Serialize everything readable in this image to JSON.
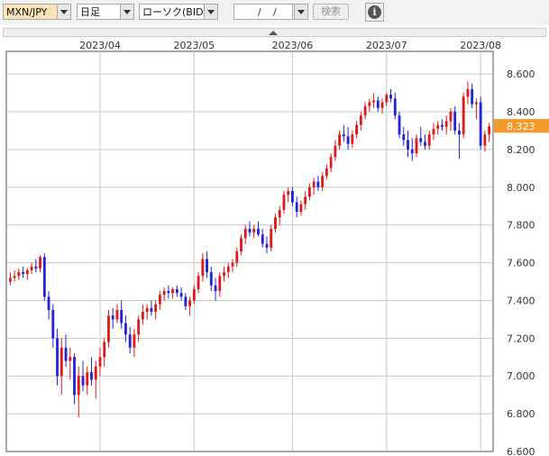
{
  "toolbar": {
    "symbol": "MXN/JPY",
    "period": "日足",
    "chart_type": "ローソク(BID)",
    "date_sep1": "/",
    "date_sep2": "/",
    "search_label": "検索",
    "info_label": "i"
  },
  "colors": {
    "up": "#e01a1a",
    "down": "#2424d6",
    "grid": "#c8c8c8",
    "badge": "#f39a2b"
  },
  "chart_data": {
    "type": "candlestick",
    "x_tick_labels": [
      "2023/04",
      "2023/05",
      "2023/06",
      "2023/07",
      "2023/08"
    ],
    "y_tick_labels": [
      "8.600",
      "8.400",
      "8.200",
      "8.000",
      "7.800",
      "7.600",
      "7.400",
      "7.200",
      "7.000",
      "6.800",
      "6.600"
    ],
    "y_ticks": [
      8.6,
      8.4,
      8.2,
      8.0,
      7.8,
      7.6,
      7.4,
      7.2,
      7.0,
      6.8,
      6.6
    ],
    "ylim": [
      6.6,
      8.72
    ],
    "current_price": 8.323,
    "current_price_label": "8.323",
    "month_start_index": [
      21,
      43,
      66,
      88,
      110
    ],
    "ohlc": [
      [
        7.5,
        7.55,
        7.48,
        7.52
      ],
      [
        7.52,
        7.56,
        7.5,
        7.53
      ],
      [
        7.53,
        7.57,
        7.51,
        7.55
      ],
      [
        7.55,
        7.58,
        7.52,
        7.54
      ],
      [
        7.54,
        7.57,
        7.51,
        7.56
      ],
      [
        7.56,
        7.6,
        7.54,
        7.58
      ],
      [
        7.58,
        7.62,
        7.55,
        7.57
      ],
      [
        7.57,
        7.64,
        7.55,
        7.63
      ],
      [
        7.63,
        7.65,
        7.4,
        7.42
      ],
      [
        7.42,
        7.45,
        7.3,
        7.35
      ],
      [
        7.35,
        7.38,
        7.15,
        7.2
      ],
      [
        7.2,
        7.25,
        6.95,
        7.0
      ],
      [
        7.0,
        7.2,
        6.9,
        7.15
      ],
      [
        7.15,
        7.22,
        7.05,
        7.08
      ],
      [
        7.08,
        7.15,
        6.98,
        7.1
      ],
      [
        7.1,
        7.12,
        6.85,
        6.9
      ],
      [
        6.9,
        7.05,
        6.78,
        7.0
      ],
      [
        7.0,
        7.08,
        6.92,
        6.95
      ],
      [
        6.95,
        7.05,
        6.9,
        7.02
      ],
      [
        7.02,
        7.1,
        6.95,
        6.98
      ],
      [
        6.98,
        7.08,
        6.88,
        7.05
      ],
      [
        7.05,
        7.15,
        7.0,
        7.1
      ],
      [
        7.1,
        7.2,
        7.05,
        7.18
      ],
      [
        7.18,
        7.35,
        7.15,
        7.32
      ],
      [
        7.32,
        7.36,
        7.25,
        7.3
      ],
      [
        7.3,
        7.38,
        7.28,
        7.35
      ],
      [
        7.35,
        7.4,
        7.25,
        7.28
      ],
      [
        7.28,
        7.32,
        7.18,
        7.22
      ],
      [
        7.22,
        7.26,
        7.12,
        7.15
      ],
      [
        7.15,
        7.25,
        7.1,
        7.22
      ],
      [
        7.22,
        7.32,
        7.18,
        7.3
      ],
      [
        7.3,
        7.38,
        7.27,
        7.34
      ],
      [
        7.34,
        7.38,
        7.3,
        7.36
      ],
      [
        7.36,
        7.4,
        7.32,
        7.34
      ],
      [
        7.34,
        7.4,
        7.3,
        7.38
      ],
      [
        7.38,
        7.45,
        7.35,
        7.43
      ],
      [
        7.43,
        7.47,
        7.4,
        7.45
      ],
      [
        7.45,
        7.48,
        7.41,
        7.44
      ],
      [
        7.44,
        7.47,
        7.41,
        7.46
      ],
      [
        7.46,
        7.48,
        7.42,
        7.44
      ],
      [
        7.44,
        7.47,
        7.4,
        7.42
      ],
      [
        7.42,
        7.44,
        7.35,
        7.37
      ],
      [
        7.37,
        7.42,
        7.32,
        7.4
      ],
      [
        7.4,
        7.48,
        7.38,
        7.46
      ],
      [
        7.46,
        7.55,
        7.44,
        7.53
      ],
      [
        7.53,
        7.65,
        7.5,
        7.62
      ],
      [
        7.62,
        7.66,
        7.52,
        7.55
      ],
      [
        7.55,
        7.58,
        7.45,
        7.48
      ],
      [
        7.48,
        7.52,
        7.4,
        7.45
      ],
      [
        7.45,
        7.55,
        7.42,
        7.53
      ],
      [
        7.53,
        7.58,
        7.5,
        7.55
      ],
      [
        7.55,
        7.6,
        7.52,
        7.58
      ],
      [
        7.58,
        7.62,
        7.55,
        7.6
      ],
      [
        7.6,
        7.68,
        7.58,
        7.66
      ],
      [
        7.66,
        7.75,
        7.64,
        7.73
      ],
      [
        7.73,
        7.8,
        7.7,
        7.78
      ],
      [
        7.78,
        7.82,
        7.74,
        7.76
      ],
      [
        7.76,
        7.8,
        7.73,
        7.78
      ],
      [
        7.78,
        7.82,
        7.74,
        7.75
      ],
      [
        7.75,
        7.78,
        7.68,
        7.7
      ],
      [
        7.7,
        7.74,
        7.65,
        7.68
      ],
      [
        7.68,
        7.8,
        7.66,
        7.78
      ],
      [
        7.78,
        7.86,
        7.76,
        7.84
      ],
      [
        7.84,
        7.9,
        7.8,
        7.88
      ],
      [
        7.88,
        7.98,
        7.86,
        7.96
      ],
      [
        7.96,
        8.0,
        7.92,
        7.98
      ],
      [
        7.98,
        8.0,
        7.9,
        7.92
      ],
      [
        7.92,
        7.95,
        7.84,
        7.87
      ],
      [
        7.87,
        7.93,
        7.85,
        7.91
      ],
      [
        7.91,
        7.98,
        7.88,
        7.95
      ],
      [
        7.95,
        8.02,
        7.93,
        8.0
      ],
      [
        8.0,
        8.05,
        7.96,
        8.03
      ],
      [
        8.03,
        8.06,
        7.98,
        8.0
      ],
      [
        8.0,
        8.08,
        7.98,
        8.06
      ],
      [
        8.06,
        8.12,
        8.04,
        8.1
      ],
      [
        8.1,
        8.18,
        8.08,
        8.16
      ],
      [
        8.16,
        8.25,
        8.14,
        8.22
      ],
      [
        8.22,
        8.3,
        8.2,
        8.28
      ],
      [
        8.28,
        8.33,
        8.24,
        8.27
      ],
      [
        8.27,
        8.32,
        8.2,
        8.23
      ],
      [
        8.23,
        8.3,
        8.21,
        8.28
      ],
      [
        8.28,
        8.35,
        8.26,
        8.33
      ],
      [
        8.33,
        8.4,
        8.3,
        8.38
      ],
      [
        8.38,
        8.45,
        8.36,
        8.43
      ],
      [
        8.43,
        8.47,
        8.4,
        8.45
      ],
      [
        8.45,
        8.5,
        8.42,
        8.46
      ],
      [
        8.46,
        8.48,
        8.4,
        8.42
      ],
      [
        8.42,
        8.47,
        8.39,
        8.45
      ],
      [
        8.45,
        8.5,
        8.43,
        8.49
      ],
      [
        8.49,
        8.52,
        8.45,
        8.47
      ],
      [
        8.47,
        8.5,
        8.36,
        8.38
      ],
      [
        8.38,
        8.4,
        8.26,
        8.28
      ],
      [
        8.28,
        8.32,
        8.22,
        8.25
      ],
      [
        8.25,
        8.3,
        8.16,
        8.2
      ],
      [
        8.2,
        8.26,
        8.14,
        8.18
      ],
      [
        8.18,
        8.28,
        8.16,
        8.26
      ],
      [
        8.26,
        8.32,
        8.22,
        8.24
      ],
      [
        8.24,
        8.28,
        8.2,
        8.22
      ],
      [
        8.22,
        8.3,
        8.2,
        8.28
      ],
      [
        8.28,
        8.34,
        8.25,
        8.31
      ],
      [
        8.31,
        8.35,
        8.28,
        8.33
      ],
      [
        8.33,
        8.36,
        8.3,
        8.32
      ],
      [
        8.32,
        8.38,
        8.28,
        8.35
      ],
      [
        8.35,
        8.42,
        8.3,
        8.4
      ],
      [
        8.4,
        8.43,
        8.28,
        8.3
      ],
      [
        8.3,
        8.34,
        8.15,
        8.28
      ],
      [
        8.28,
        8.5,
        8.26,
        8.48
      ],
      [
        8.48,
        8.56,
        8.44,
        8.52
      ],
      [
        8.52,
        8.55,
        8.42,
        8.44
      ],
      [
        8.44,
        8.47,
        8.36,
        8.45
      ],
      [
        8.45,
        8.48,
        8.2,
        8.22
      ],
      [
        8.22,
        8.3,
        8.19,
        8.28
      ],
      [
        8.28,
        8.34,
        8.24,
        8.323
      ]
    ]
  }
}
